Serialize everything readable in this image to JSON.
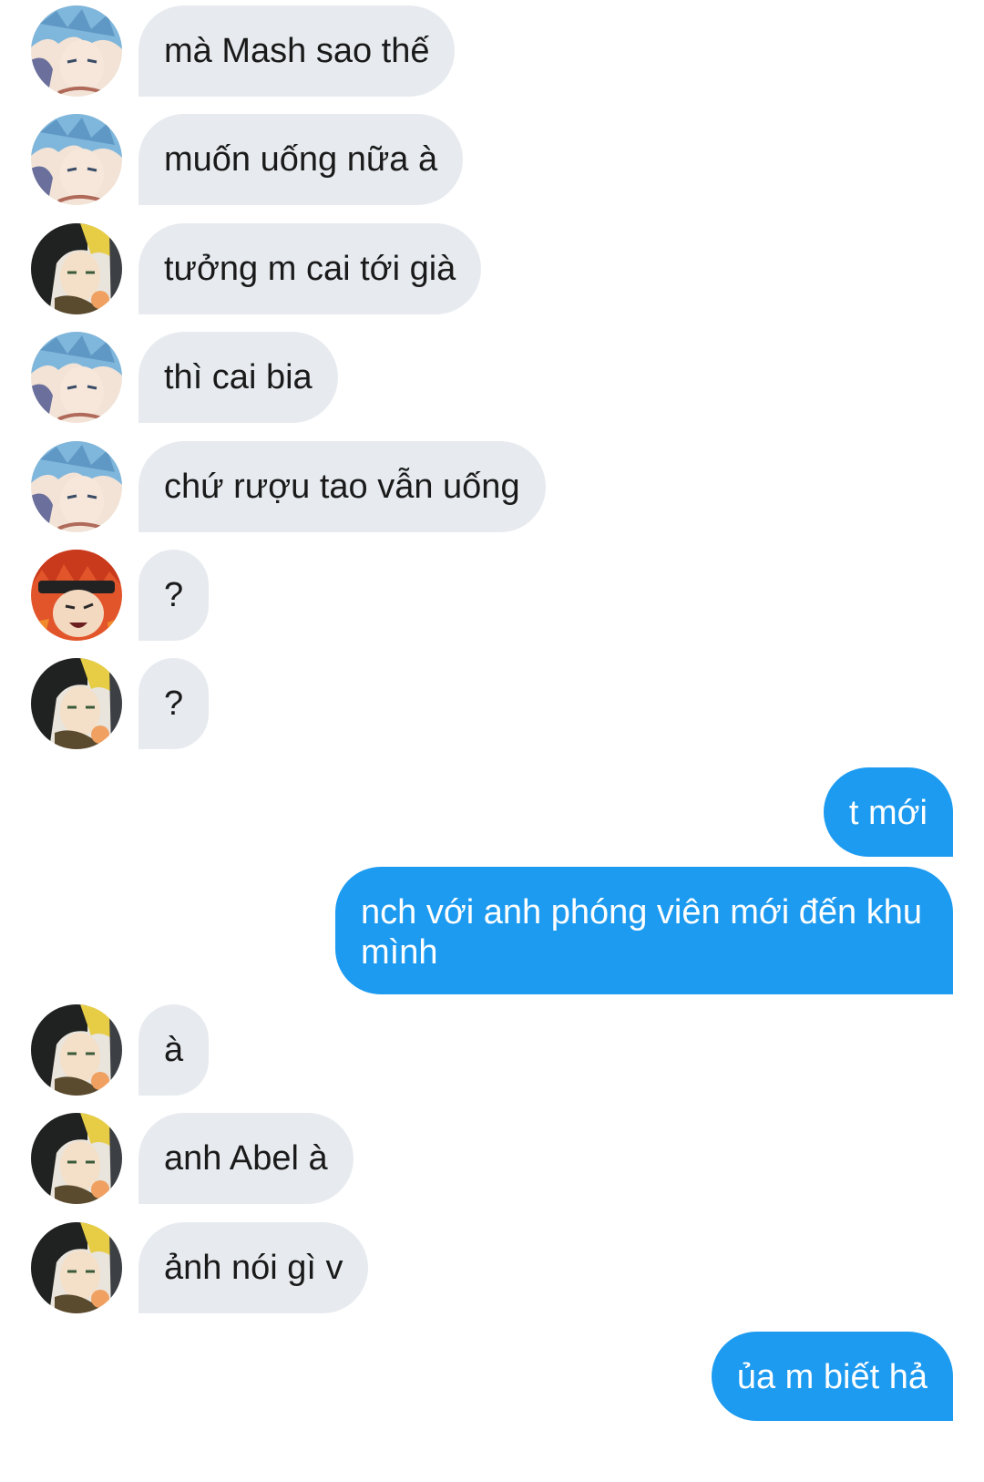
{
  "conversation": {
    "messages": [
      {
        "side": "in",
        "avatar": "avatar-blue-hair",
        "text": "mà Mash sao thế"
      },
      {
        "side": "in",
        "avatar": "avatar-blue-hair",
        "text": "muốn uống nữa à"
      },
      {
        "side": "in",
        "avatar": "avatar-dark-blond-hair",
        "text": "tưởng m cai tới già"
      },
      {
        "side": "in",
        "avatar": "avatar-blue-hair",
        "text": "thì cai bia"
      },
      {
        "side": "in",
        "avatar": "avatar-blue-hair",
        "text": "chứ rượu tao vẫn uống"
      },
      {
        "side": "in",
        "avatar": "avatar-red-hair",
        "text": "?"
      },
      {
        "side": "in",
        "avatar": "avatar-dark-blond-hair",
        "text": "?"
      },
      {
        "side": "out",
        "text": "t mới"
      },
      {
        "side": "out",
        "text": "nch với anh phóng viên mới đến khu mình"
      },
      {
        "side": "in",
        "avatar": "avatar-dark-blond-hair",
        "text": "à"
      },
      {
        "side": "in",
        "avatar": "avatar-dark-blond-hair",
        "text": "anh Abel à"
      },
      {
        "side": "in",
        "avatar": "avatar-dark-blond-hair",
        "text": "ảnh nói gì v"
      },
      {
        "side": "out",
        "text": "ủa m biết hả"
      }
    ]
  },
  "colors": {
    "incoming_bubble": "#e7ebef",
    "outgoing_bubble": "#1d9bf0",
    "background": "#ffffff"
  }
}
